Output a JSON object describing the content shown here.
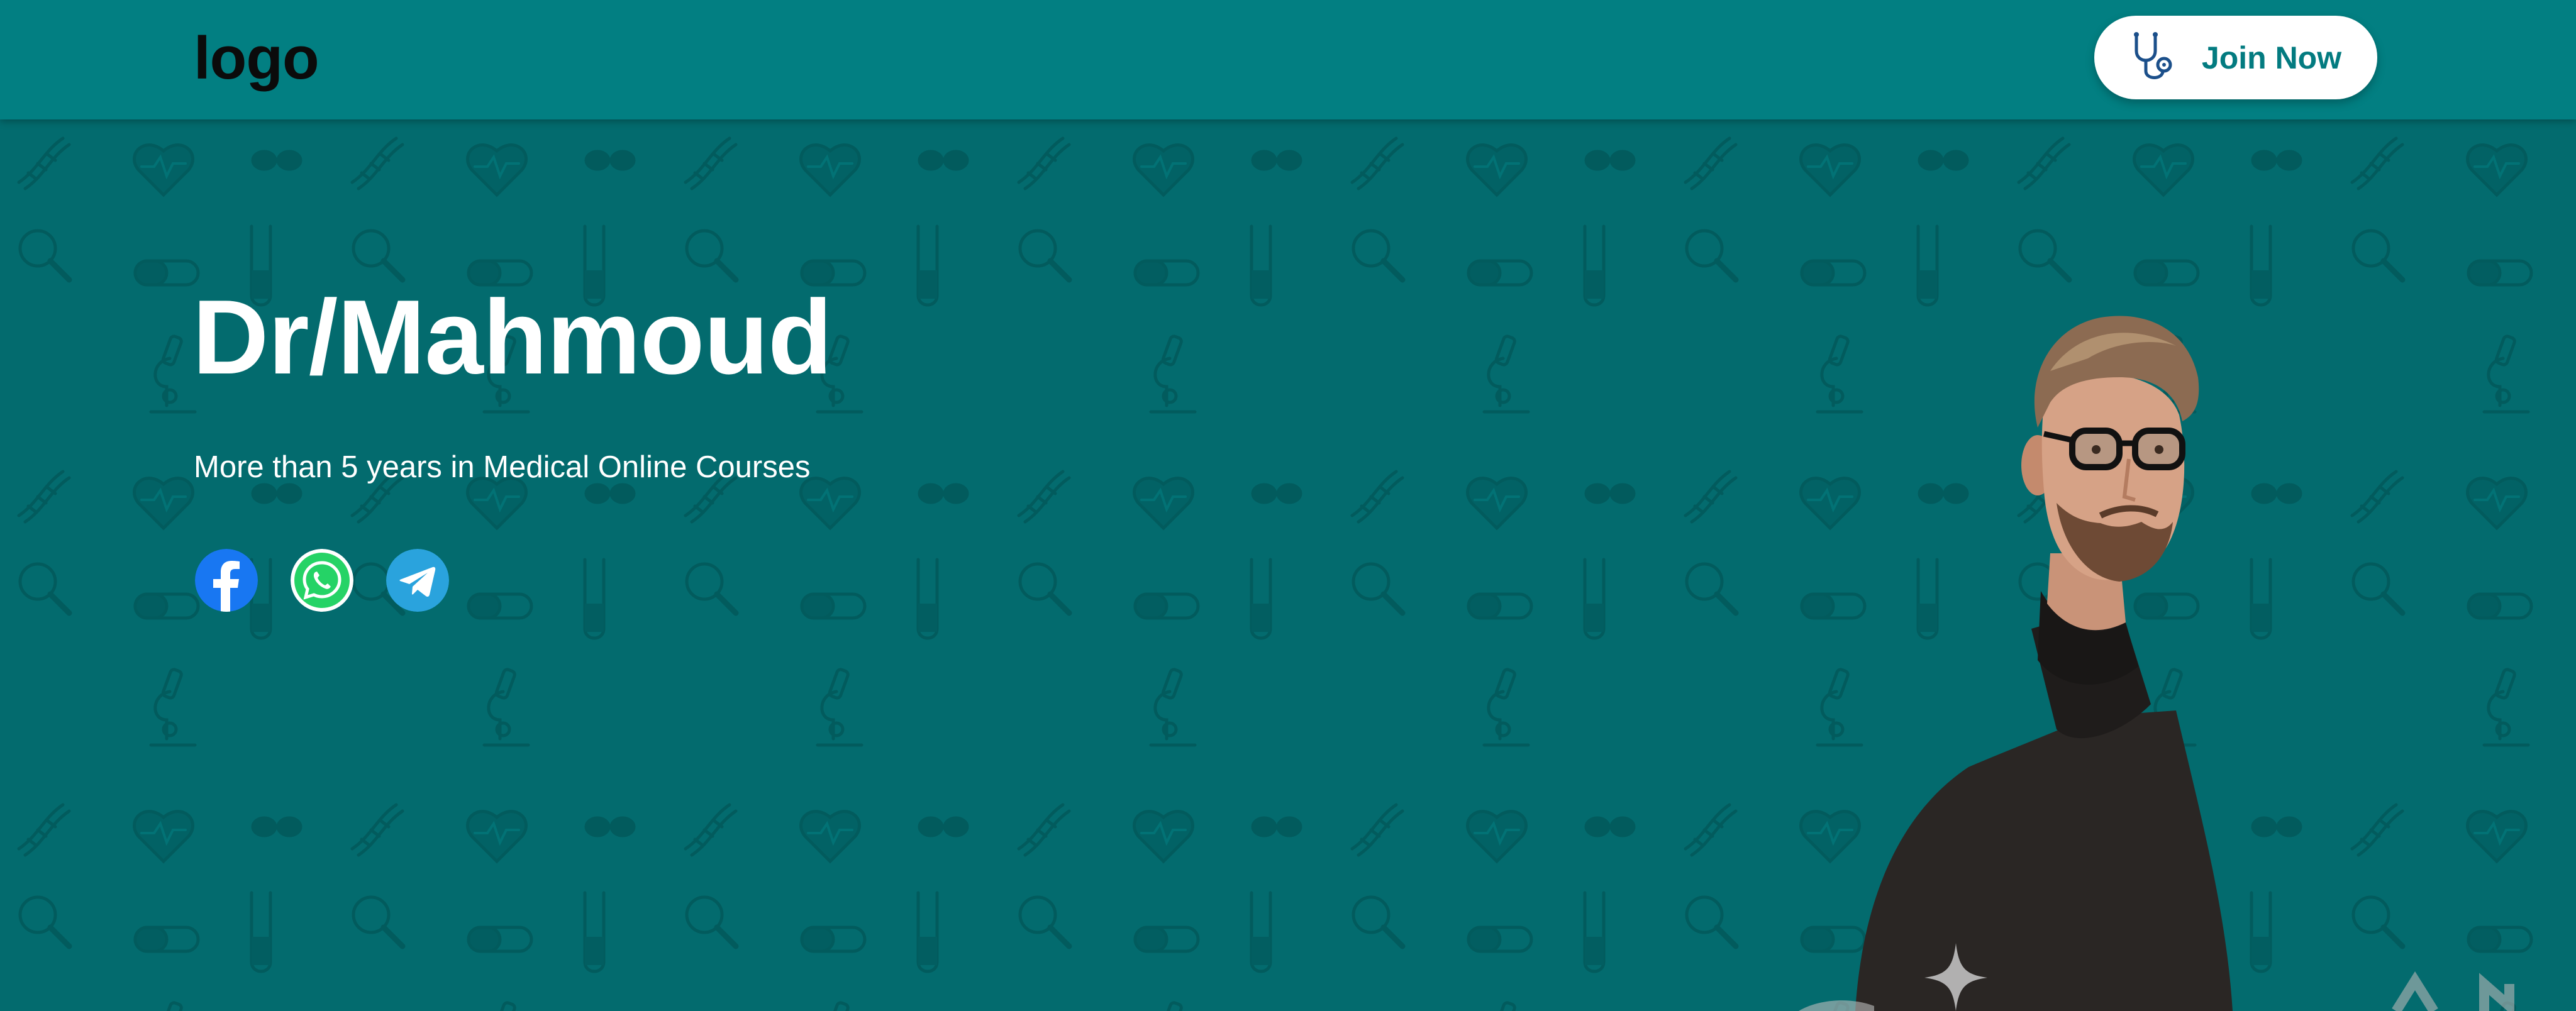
{
  "header": {
    "logo": "logo",
    "join_label": "Join Now",
    "join_icon": "stethoscope-icon"
  },
  "hero": {
    "title": "Dr/Mahmoud",
    "subtitle": "More than 5 years in Medical Online Courses"
  },
  "socials": [
    {
      "name": "facebook-icon",
      "color": "#1877f2"
    },
    {
      "name": "whatsapp-icon",
      "color": "#25d366"
    },
    {
      "name": "telegram-icon",
      "color": "#2aa3dd"
    }
  ],
  "colors": {
    "header_bg": "#027f82",
    "hero_bg": "#036b6e",
    "accent": "#037b80",
    "pattern": "#025a5c"
  },
  "background_pattern_icons": [
    "dna-icon",
    "heart-pulse-icon",
    "lungs-icon",
    "magnifier-icon",
    "pill-icon",
    "test-tube-icon",
    "microscope-icon"
  ]
}
